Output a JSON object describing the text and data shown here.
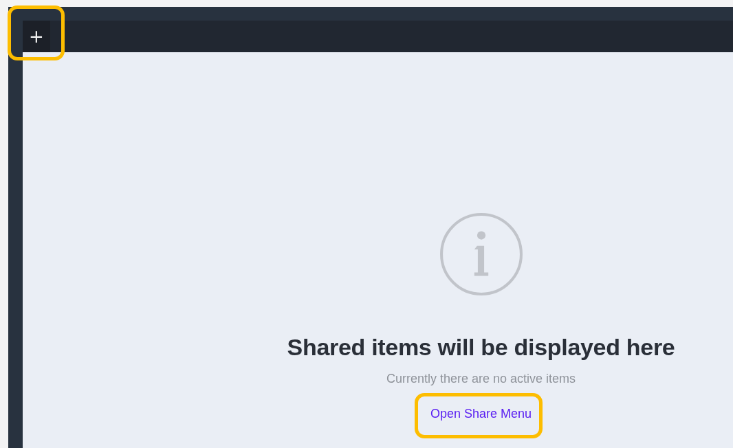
{
  "toolbar": {
    "add_button": {
      "label": "+",
      "highlighted": true
    }
  },
  "empty_state": {
    "title": "Shared items will be displayed here",
    "message": "Currently there are no active items",
    "link": {
      "label": "Open Share Menu",
      "highlighted": true
    }
  }
}
